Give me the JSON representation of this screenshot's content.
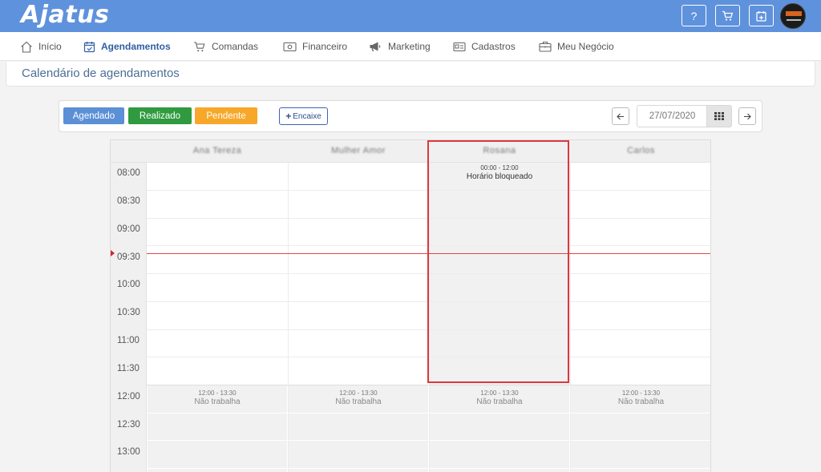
{
  "app": {
    "logo_text": "Ajatus",
    "brand_color": "#5f92dc"
  },
  "topbar": {
    "help_label": "?",
    "cart_icon": "cart-icon",
    "calendar_icon": "calendar-plus-icon",
    "avatar_icon": "user-avatar"
  },
  "nav": {
    "items": [
      {
        "label": "Início",
        "icon": "home-icon"
      },
      {
        "label": "Agendamentos",
        "icon": "calendar-check-icon",
        "active": true
      },
      {
        "label": "Comandas",
        "icon": "cart-icon"
      },
      {
        "label": "Financeiro",
        "icon": "money-icon"
      },
      {
        "label": "Marketing",
        "icon": "megaphone-icon"
      },
      {
        "label": "Cadastros",
        "icon": "id-card-icon"
      },
      {
        "label": "Meu Negócio",
        "icon": "briefcase-icon"
      }
    ]
  },
  "page": {
    "title": "Calendário de agendamentos"
  },
  "toolbar": {
    "legend": [
      {
        "label": "Agendado",
        "color": "#5b8fd6"
      },
      {
        "label": "Realizado",
        "color": "#2f9a3f"
      },
      {
        "label": "Pendente",
        "color": "#f7a82a"
      }
    ],
    "encaixe_label": "Encaixe",
    "date_value": "27/07/2020"
  },
  "calendar": {
    "columns": [
      "Ana Tereza",
      "Mulher Amor",
      "Rosana",
      "Carlos"
    ],
    "times": [
      "08:00",
      "08:30",
      "09:00",
      "09:30",
      "10:00",
      "10:30",
      "11:00",
      "11:30",
      "12:00",
      "12:30",
      "13:00"
    ],
    "blocked_morning": {
      "range": "00:00 - 12:00",
      "label": "Horário bloqueado"
    },
    "lunch": {
      "range": "12:00 - 13:30",
      "label": "Não trabalha"
    },
    "now_color": "#e0464a",
    "highlight_color": "#d9393f"
  }
}
